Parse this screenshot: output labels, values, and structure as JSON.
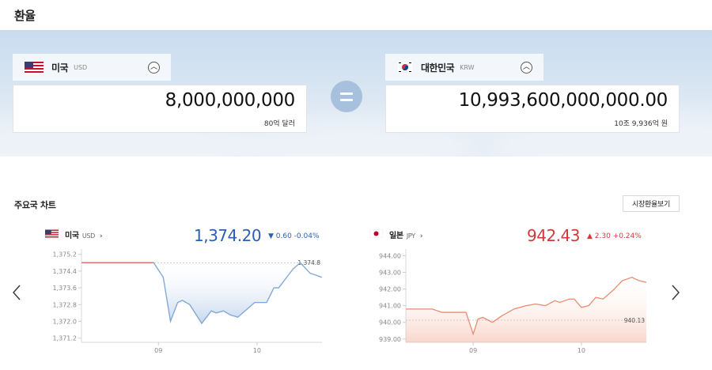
{
  "page": {
    "title": "환율"
  },
  "converter": {
    "from": {
      "country": "미국",
      "code": "USD",
      "amount": "8,000,000,000",
      "amount_words": "80억 달러"
    },
    "to": {
      "country": "대한민국",
      "code": "KRW",
      "amount": "10,993,600,000,000.00",
      "amount_words": "10조 9,936억 원"
    },
    "collapse_icon": "chevron-up-icon",
    "equals_icon": "equals-icon"
  },
  "charts_section": {
    "title": "주요국 차트",
    "market_button": "시장환율보기",
    "prev_icon": "chevron-left-icon",
    "next_icon": "chevron-right-icon"
  },
  "colors": {
    "up": "#d03a3a",
    "down": "#2c5fb1",
    "usd_line": "#7da4d8",
    "jpy_line": "#e88c6e",
    "baseline": "#e06b5a"
  },
  "chart_data": [
    {
      "type": "area",
      "country": "미국",
      "code": "USD",
      "chevron": "›",
      "price": "1,374.20",
      "direction": "down",
      "change_text": "▼ 0.60  -0.04%",
      "y_ticks": [
        "1,375.2",
        "1,374.4",
        "1,373.6",
        "1,372.8",
        "1,372.0",
        "1,371.2"
      ],
      "y_tick_values": [
        1375.2,
        1374.4,
        1373.6,
        1372.8,
        1372.0,
        1371.2
      ],
      "x_ticks": [
        "09",
        "10"
      ],
      "x_tick_at": [
        0.32,
        0.73
      ],
      "ylim": [
        1371.0,
        1375.45
      ],
      "baseline_value": 1374.8,
      "baseline_label": "1,374.8",
      "series_x": [
        0.0,
        0.3,
        0.34,
        0.37,
        0.4,
        0.42,
        0.45,
        0.5,
        0.54,
        0.56,
        0.59,
        0.62,
        0.65,
        0.69,
        0.72,
        0.77,
        0.8,
        0.82,
        0.86,
        0.88,
        0.91,
        0.95,
        1.0
      ],
      "series_y": [
        1374.8,
        1374.8,
        1374.1,
        1372.0,
        1372.9,
        1373.0,
        1372.8,
        1371.9,
        1372.5,
        1372.4,
        1372.5,
        1372.3,
        1372.2,
        1372.6,
        1372.9,
        1372.9,
        1373.6,
        1373.6,
        1374.2,
        1374.5,
        1374.8,
        1374.3,
        1374.1
      ]
    },
    {
      "type": "area",
      "country": "일본",
      "code": "JPY",
      "chevron": "›",
      "price": "942.43",
      "direction": "up",
      "change_text": "▲ 2.30  +0.24%",
      "y_ticks": [
        "944.00",
        "943.00",
        "942.00",
        "941.00",
        "940.00",
        "939.00"
      ],
      "y_tick_values": [
        944.0,
        943.0,
        942.0,
        941.0,
        940.0,
        939.0
      ],
      "x_ticks": [
        "09",
        "10"
      ],
      "x_tick_at": [
        0.28,
        0.73
      ],
      "ylim": [
        938.8,
        944.4
      ],
      "baseline_value": 940.13,
      "baseline_label": "940.13",
      "series_x": [
        0.0,
        0.11,
        0.15,
        0.25,
        0.28,
        0.3,
        0.32,
        0.36,
        0.4,
        0.45,
        0.5,
        0.54,
        0.58,
        0.62,
        0.64,
        0.68,
        0.7,
        0.73,
        0.76,
        0.79,
        0.82,
        0.86,
        0.9,
        0.94,
        0.97,
        1.0
      ],
      "series_y": [
        940.8,
        940.8,
        940.6,
        940.6,
        939.3,
        940.2,
        940.3,
        940.0,
        940.4,
        940.8,
        941.0,
        941.1,
        941.0,
        941.3,
        941.2,
        941.4,
        941.4,
        940.9,
        941.0,
        941.5,
        941.4,
        941.9,
        942.5,
        942.7,
        942.5,
        942.4
      ]
    }
  ]
}
